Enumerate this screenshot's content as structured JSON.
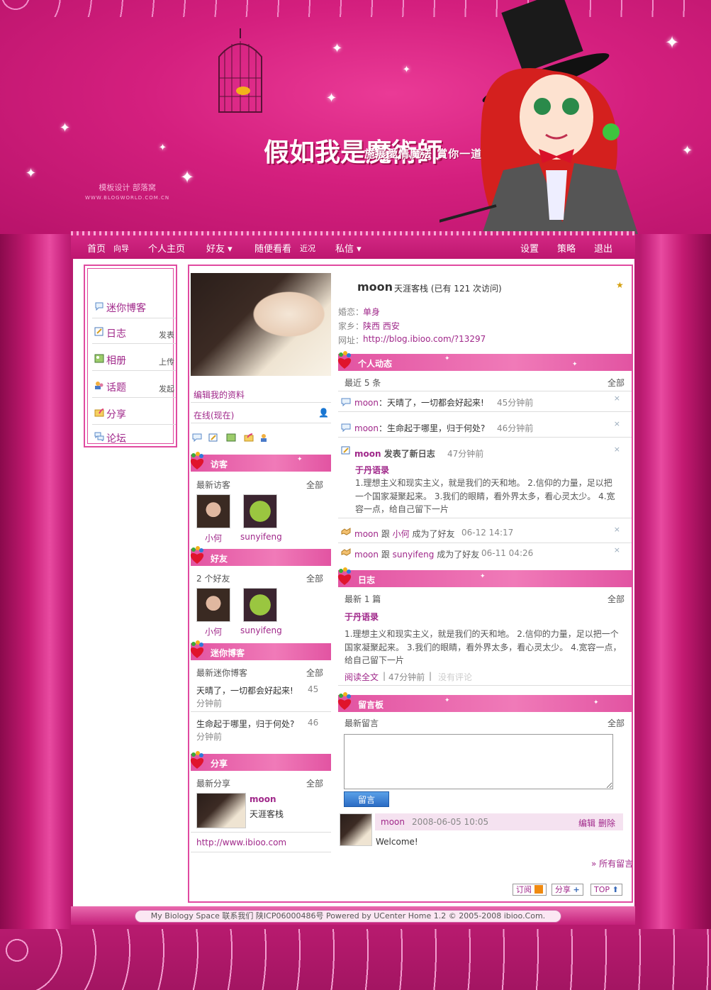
{
  "header": {
    "slogan_big": "假如我是魔術師",
    "slogan_small": "施展愛情魔法 賞你一道愛的光芒",
    "credit": "模板设计 部落窝",
    "credit_url": "WWW.BLOGWORLD.COM.CN"
  },
  "nav": {
    "left": [
      {
        "label": "首页",
        "small": false
      },
      {
        "label": "向导",
        "small": true
      },
      {
        "label": "个人主页",
        "small": false
      },
      {
        "label": "好友 ▾",
        "small": false
      },
      {
        "label": "随便看看",
        "small": false
      },
      {
        "label": "近况",
        "small": true
      },
      {
        "label": "私信 ▾",
        "small": false
      }
    ],
    "right": [
      "设置",
      "策略",
      "退出"
    ]
  },
  "menu": [
    {
      "label": "迷你博客",
      "extra": ""
    },
    {
      "label": "日志",
      "extra": "发表"
    },
    {
      "label": "相册",
      "extra": "上传"
    },
    {
      "label": "话题",
      "extra": "发起"
    },
    {
      "label": "分享",
      "extra": ""
    },
    {
      "label": "论坛",
      "extra": ""
    }
  ],
  "profile": {
    "name": "moon",
    "subtitle": "天涯客栈 (已有 121 次访问)",
    "fields": [
      {
        "label": "婚恋：",
        "value": "单身"
      },
      {
        "label": "家乡：",
        "value": "陕西 西安"
      },
      {
        "label": "网址：",
        "value": "http://blog.ibioo.com/?13297"
      }
    ],
    "edit_link": "编辑我的资料",
    "online": "在线(现在)"
  },
  "visitors": {
    "title": "访客",
    "sub": "最新访客",
    "all": "全部",
    "people": [
      "小何",
      "sunyifeng"
    ]
  },
  "friends": {
    "title": "好友",
    "sub": "2 个好友",
    "all": "全部",
    "people": [
      "小何",
      "sunyifeng"
    ]
  },
  "miniblog": {
    "title": "迷你博客",
    "sub": "最新迷你博客",
    "all": "全部",
    "items": [
      {
        "line1": "天晴了，一切都会好起来!",
        "num": "45",
        "line2": "分钟前"
      },
      {
        "line1": "生命起于哪里，归于何处?",
        "num": "46",
        "line2": "分钟前"
      }
    ]
  },
  "share": {
    "title": "分享",
    "sub": "最新分享",
    "all": "全部",
    "name": "moon",
    "desc": "天涯客栈",
    "url": "http://www.ibioo.com"
  },
  "activity": {
    "title": "个人动态",
    "sub": "最近 5 条",
    "all": "全部",
    "items": [
      {
        "user": "moon",
        "text": "：天晴了，一切都会好起来!",
        "time": "45分钟前"
      },
      {
        "user": "moon",
        "text": "：生命起于哪里，归于何处?",
        "time": "46分钟前"
      }
    ],
    "post": {
      "user": "moon",
      "action": "发表了新日志",
      "time": "47分钟前",
      "title": "于丹语录",
      "body": [
        "1.理想主义和现实主义，就是我们的天和地。 2.信仰的力量，足以把",
        "一个国家凝聚起来。 3.我们的眼睛，看外界太多，看心灵太少。 4.宽",
        "容一点，给自己留下一片"
      ]
    },
    "friends": [
      {
        "a": "moon",
        "mid": "跟",
        "b": "小何",
        "tail": "成为了好友",
        "time": "06-12 14:17"
      },
      {
        "a": "moon",
        "mid": "跟",
        "b": "sunyifeng",
        "tail": "成为了好友",
        "time": "06-11 04:26"
      }
    ]
  },
  "blog": {
    "title": "日志",
    "sub": "最新 1 篇",
    "all": "全部",
    "post_title": "于丹语录",
    "body": [
      "1.理想主义和现实主义，就是我们的天和地。 2.信仰的力量，足以把一个",
      "国家凝聚起来。 3.我们的眼睛，看外界太多，看心灵太少。 4.宽容一点，",
      "给自己留下一片"
    ],
    "read": "阅读全文",
    "time": "47分钟前",
    "comment": "没有评论"
  },
  "guestbook": {
    "title": "留言板",
    "sub": "最新留言",
    "all": "全部",
    "button": "留言",
    "msg": {
      "user": "moon",
      "time": "2008-06-05 10:05",
      "edit": "编辑",
      "del": "删除",
      "text": "Welcome!"
    },
    "more": "» 所有留言"
  },
  "tags": [
    "订阅",
    "分享",
    "TOP"
  ],
  "footer": "My Biology Space   联系我们   陕ICP06000486号    Powered by UCenter Home 1.2 © 2005-2008 ibioo.Com."
}
